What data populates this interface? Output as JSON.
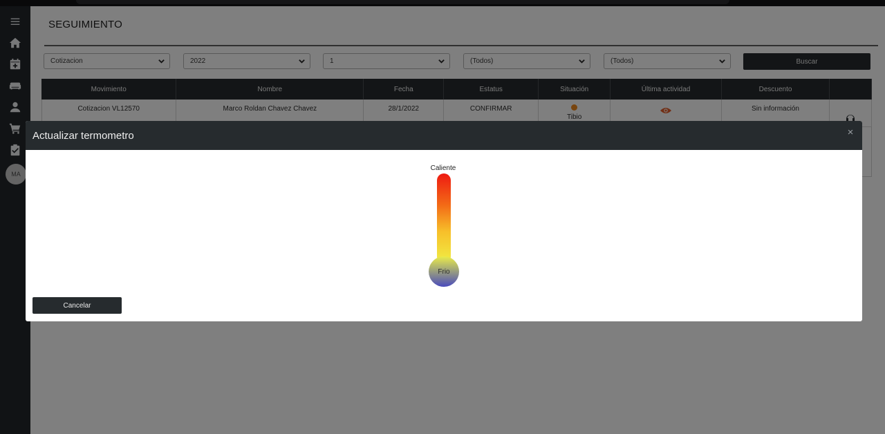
{
  "page": {
    "title": "SEGUIMIENTO"
  },
  "sidebar": {
    "icons": [
      "menu-icon",
      "home-icon",
      "calendar-plus-icon",
      "sofa-icon",
      "user-icon",
      "cart-icon",
      "clipboard-check-icon"
    ],
    "avatar_initials": "MA"
  },
  "filters": {
    "tipo": "Cotizacion",
    "anio": "2022",
    "mes": "1",
    "filtro4": "(Todos)",
    "filtro5": "(Todos)",
    "search_label": "Buscar"
  },
  "table": {
    "headers": [
      "Movimiento",
      "Nombre",
      "Fecha",
      "Estatus",
      "Situación",
      "Última actividad",
      "Descuento",
      ""
    ],
    "rows": [
      {
        "movimiento": "Cotizacion VL12570",
        "nombre": "Marco Roldan Chavez Chavez",
        "fecha": "28/1/2022",
        "estatus": "CONFIRMAR",
        "situacion": "Tibio",
        "ultima_actividad_icon": "eye-icon",
        "descuento": "Sin información"
      }
    ]
  },
  "modal": {
    "title": "Actualizar termometro",
    "close_label": "×",
    "hot_label": "Caliente",
    "cold_label": "Frio",
    "cancel_label": "Cancelar"
  },
  "colors": {
    "dark": "#262b2e",
    "situacion_dot": "#f08a1f",
    "eye_icon": "#e45f2a",
    "thermo_hot": "#ee1a12",
    "thermo_cold": "#4a4bbd"
  }
}
